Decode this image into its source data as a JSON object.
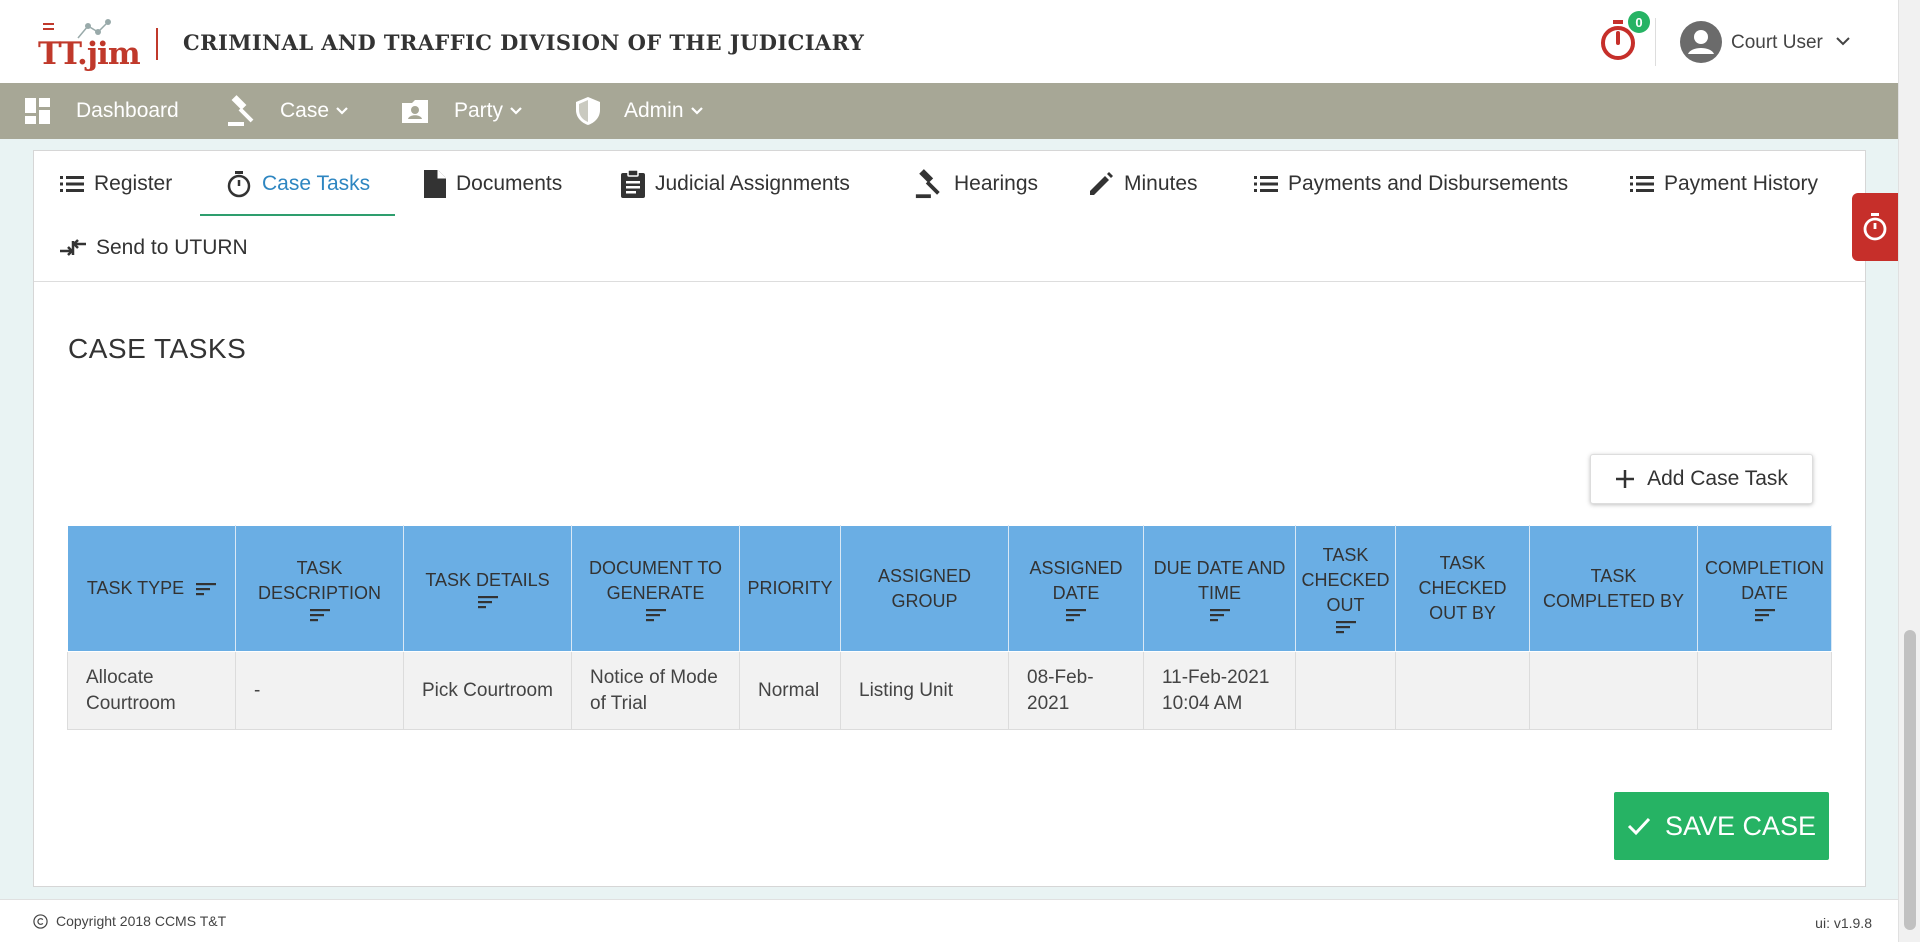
{
  "header": {
    "logo_text": "TT.jim",
    "title": "CRIMINAL AND TRAFFIC DIVISION OF THE JUDICIARY",
    "timer_badge": "0",
    "user_name": "Court User"
  },
  "nav": {
    "items": [
      {
        "label": "Dashboard",
        "icon": "dashboard-icon",
        "dropdown": false
      },
      {
        "label": "Case",
        "icon": "gavel-icon",
        "dropdown": true
      },
      {
        "label": "Party",
        "icon": "contact-card-icon",
        "dropdown": true
      },
      {
        "label": "Admin",
        "icon": "shield-icon",
        "dropdown": true
      }
    ]
  },
  "tabs": [
    {
      "label": "Register",
      "icon": "list-icon",
      "active": false
    },
    {
      "label": "Case Tasks",
      "icon": "timer-icon",
      "active": true
    },
    {
      "label": "Documents",
      "icon": "document-icon",
      "active": false
    },
    {
      "label": "Judicial Assignments",
      "icon": "clipboard-icon",
      "active": false
    },
    {
      "label": "Hearings",
      "icon": "gavel-icon",
      "active": false
    },
    {
      "label": "Minutes",
      "icon": "pencil-icon",
      "active": false
    },
    {
      "label": "Payments and Disbursements",
      "icon": "list-icon",
      "active": false
    },
    {
      "label": "Payment History",
      "icon": "list-icon",
      "active": false
    },
    {
      "label": "Send to UTURN",
      "icon": "swap-arrows-icon",
      "active": false
    }
  ],
  "section_title": "CASE TASKS",
  "add_button_label": "Add Case Task",
  "table": {
    "columns": [
      {
        "label": "TASK TYPE",
        "sortable": true
      },
      {
        "label": "TASK DESCRIPTION",
        "sortable": true
      },
      {
        "label": "TASK DETAILS",
        "sortable": true
      },
      {
        "label": "DOCUMENT TO GENERATE",
        "sortable": true
      },
      {
        "label": "PRIORITY",
        "sortable": false
      },
      {
        "label": "ASSIGNED GROUP",
        "sortable": false
      },
      {
        "label": "ASSIGNED DATE",
        "sortable": true
      },
      {
        "label": "DUE DATE AND TIME",
        "sortable": true
      },
      {
        "label": "TASK CHECKED OUT",
        "sortable": true
      },
      {
        "label": "TASK CHECKED OUT BY",
        "sortable": false
      },
      {
        "label": "TASK COMPLETED BY",
        "sortable": false
      },
      {
        "label": "COMPLETION DATE",
        "sortable": true
      }
    ],
    "rows": [
      [
        "Allocate Courtroom",
        "-",
        "Pick Courtroom",
        "Notice of Mode of Trial",
        "Normal",
        "Listing Unit",
        "08-Feb-2021",
        "11-Feb-2021 10:04 AM",
        "",
        "",
        "",
        ""
      ]
    ]
  },
  "save_button_label": "SAVE CASE",
  "footer": {
    "copyright": "Copyright 2018  CCMS T&T",
    "version": "ui: v1.9.8"
  },
  "colors": {
    "brand_red": "#c0392b",
    "nav_bg": "#a7a796",
    "table_header": "#6aaee4",
    "accent_blue": "#2e86c1",
    "save_green": "#26b364"
  }
}
